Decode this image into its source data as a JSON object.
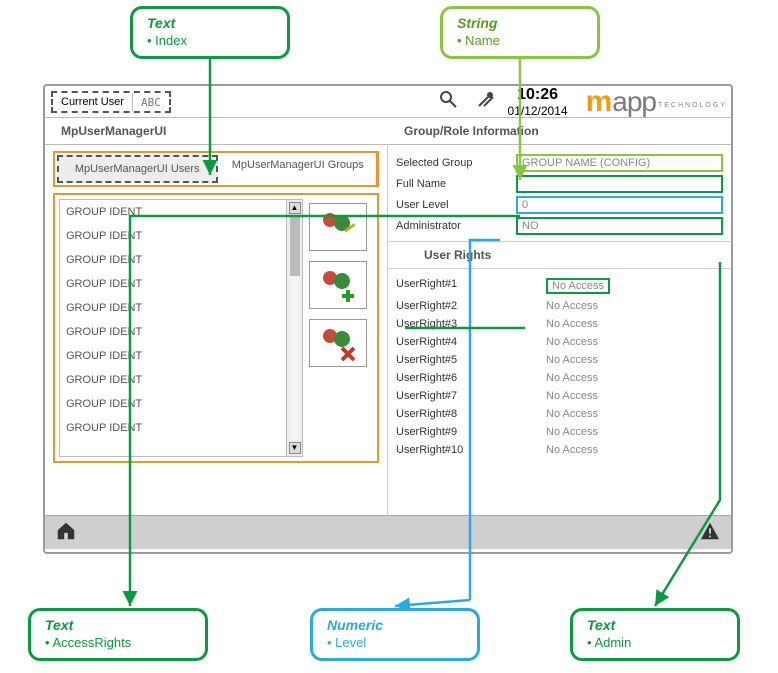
{
  "callouts": {
    "top_left": {
      "title": "Text",
      "bullet": "Index"
    },
    "top_right": {
      "title": "String",
      "bullet": "Name"
    },
    "bot_left": {
      "title": "Text",
      "bullet": "AccessRights"
    },
    "bot_mid": {
      "title": "Numeric",
      "bullet": "Level"
    },
    "bot_right": {
      "title": "Text",
      "bullet": "Admin"
    }
  },
  "topbar": {
    "current_user_label": "Current User",
    "current_user_value": "ABC",
    "time": "10:26",
    "date": "01/12/2014"
  },
  "logo": {
    "m": "m",
    "app": "app",
    "tech": "TECHNOLOGY"
  },
  "tabs": {
    "main": {
      "left": "MpUserManagerUI",
      "right": "Group/Role Information"
    },
    "sub": {
      "users": "MpUserManagerUI Users",
      "groups": "MpUserManagerUI Groups"
    }
  },
  "list": {
    "items": [
      "GROUP IDENT",
      "GROUP IDENT",
      "GROUP IDENT",
      "GROUP IDENT",
      "GROUP IDENT",
      "GROUP IDENT",
      "GROUP IDENT",
      "GROUP IDENT",
      "GROUP IDENT",
      "GROUP IDENT"
    ]
  },
  "fields": {
    "selected_group": {
      "label": "Selected Group",
      "value": "GROUP NAME (CONFIG)"
    },
    "full_name": {
      "label": "Full Name",
      "value": ""
    },
    "user_level": {
      "label": "User Level",
      "value": "0"
    },
    "administrator": {
      "label": "Administrator",
      "value": "NO"
    }
  },
  "rights": {
    "header": "User Rights",
    "rows": [
      {
        "label": "UserRight#1",
        "value": "No Access"
      },
      {
        "label": "UserRight#2",
        "value": "No Access"
      },
      {
        "label": "UserRight#3",
        "value": "No Access"
      },
      {
        "label": "UserRight#4",
        "value": "No Access"
      },
      {
        "label": "UserRight#5",
        "value": "No Access"
      },
      {
        "label": "UserRight#6",
        "value": "No Access"
      },
      {
        "label": "UserRight#7",
        "value": "No Access"
      },
      {
        "label": "UserRight#8",
        "value": "No Access"
      },
      {
        "label": "UserRight#9",
        "value": "No Access"
      },
      {
        "label": "UserRight#10",
        "value": "No Access"
      }
    ]
  }
}
